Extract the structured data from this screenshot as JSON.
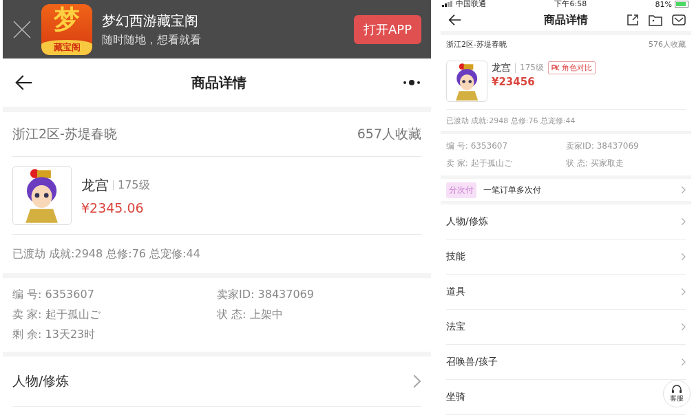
{
  "web_view": {
    "banner": {
      "app_name": "梦幻西游藏宝阁",
      "slogan": "随时随地，想看就看",
      "logo_text": "梦",
      "logo_sub": "藏宝阁",
      "open_button": "打开APP"
    },
    "nav": {
      "title": "商品详情"
    },
    "server": "浙江2区-苏堤春晓",
    "favorites": "657人收藏",
    "character": {
      "name": "龙宫",
      "level": "175级",
      "price": "¥2345.06"
    },
    "stats": "已渡劫 成就:2948 总修:76 总宠修:44",
    "info": [
      {
        "label": "编 号:",
        "value": "6353607"
      },
      {
        "label": "卖家ID:",
        "value": "38437069"
      },
      {
        "label": "卖 家:",
        "value": "起于孤山ご"
      },
      {
        "label": "状 态:",
        "value": "上架中"
      },
      {
        "label": "剩 余:",
        "value": "13天23时"
      }
    ],
    "menu": [
      "人物/修炼"
    ]
  },
  "app_view": {
    "status_bar": {
      "carrier": "中国联通",
      "time": "下午6:58",
      "battery": "81%"
    },
    "nav": {
      "title": "商品详情"
    },
    "server": "浙江2区-苏堤春晓",
    "favorites": "576人收藏",
    "character": {
      "name": "龙宫",
      "level": "175级",
      "compare_button": "角色对比",
      "price": "¥23456"
    },
    "stats": "已渡劫 成就:2948 总修:76 总宠修:44",
    "info": [
      {
        "label": "编 号:",
        "value": "6353607"
      },
      {
        "label": "卖家ID:",
        "value": "38437069"
      },
      {
        "label": "卖 家:",
        "value": "起于孤山ご"
      },
      {
        "label": "状 态:",
        "value": "买家取走"
      }
    ],
    "installment": {
      "tag": "分次付",
      "text": "一笔订单多次付"
    },
    "menu": [
      "人物/修炼",
      "技能",
      "道具",
      "法宝",
      "召唤兽/孩子",
      "坐骑"
    ],
    "service_button": "客服"
  }
}
